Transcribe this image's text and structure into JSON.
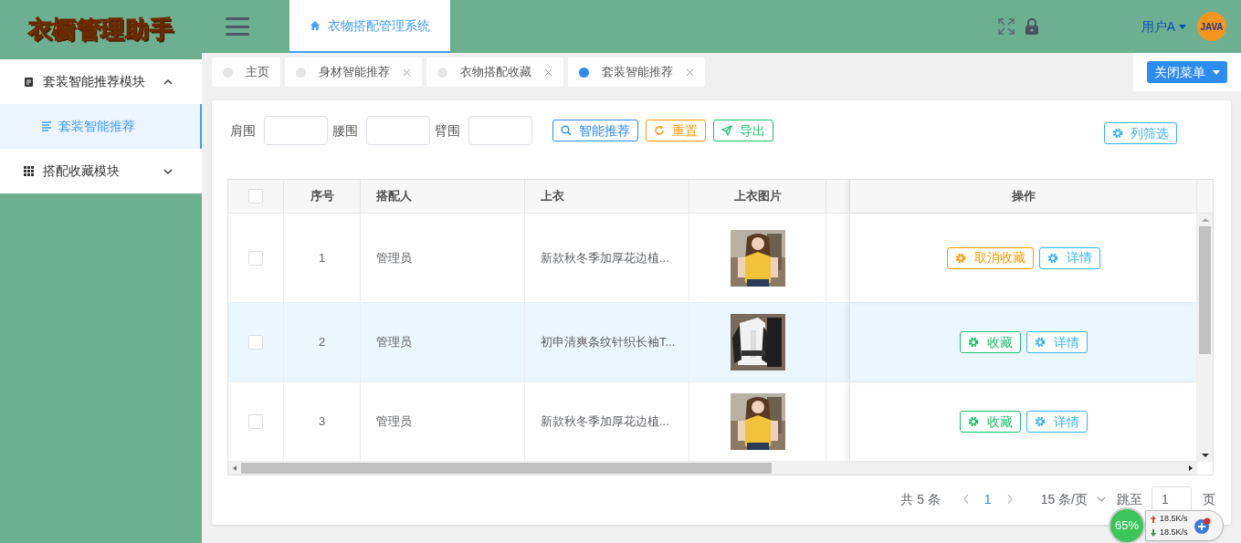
{
  "sidebar": {
    "logo": "衣橱管理助手",
    "menu": [
      {
        "label": "套装智能推荐模块",
        "expanded": true,
        "children": [
          {
            "label": "套装智能推荐",
            "selected": true
          }
        ]
      },
      {
        "label": "搭配收藏模块",
        "expanded": false
      }
    ]
  },
  "header": {
    "tab": "衣物搭配管理系统",
    "user": "用户A",
    "avatar_text": "JAVA"
  },
  "tabs": [
    {
      "label": "主页",
      "selected": false,
      "closable": false
    },
    {
      "label": "身材智能推荐",
      "selected": false,
      "closable": true
    },
    {
      "label": "衣物搭配收藏",
      "selected": false,
      "closable": true
    },
    {
      "label": "套装智能推荐",
      "selected": true,
      "closable": true
    }
  ],
  "close_menu": "关闭菜单",
  "filters": [
    {
      "label": "肩围"
    },
    {
      "label": "腰围"
    },
    {
      "label": "臂围"
    }
  ],
  "toolbar": [
    {
      "label": "智能推荐",
      "kind": "search"
    },
    {
      "label": "重置",
      "kind": "reset"
    },
    {
      "label": "导出",
      "kind": "export"
    }
  ],
  "column_filter": "列筛选",
  "table": {
    "header_checked": false,
    "columns": [
      "序号",
      "搭配人",
      "上衣",
      "上衣图片",
      "操作"
    ],
    "rows": [
      {
        "checked": false,
        "selected": false,
        "index": "1",
        "person": "管理员",
        "top": "新款秋冬季加厚花边植...",
        "actions": [
          {
            "label": "取消收藏",
            "kind": "uncollect"
          },
          {
            "label": "详情",
            "kind": "detail"
          }
        ]
      },
      {
        "checked": false,
        "selected": true,
        "index": "2",
        "person": "管理员",
        "top": "初申清爽条纹针织长袖T...",
        "actions": [
          {
            "label": "收藏",
            "kind": "collect"
          },
          {
            "label": "详情",
            "kind": "detail"
          }
        ]
      },
      {
        "checked": false,
        "selected": false,
        "index": "3",
        "person": "管理员",
        "top": "新款秋冬季加厚花边植...",
        "actions": [
          {
            "label": "收藏",
            "kind": "collect"
          },
          {
            "label": "详情",
            "kind": "detail"
          }
        ]
      }
    ]
  },
  "pagination": {
    "total": "共 5 条",
    "pages": [
      {
        "label": "1",
        "selected": true
      }
    ],
    "page_size": "15 条/页",
    "jump_label": "跳至",
    "jump_value": "1",
    "page_unit": "页"
  },
  "net_widget": {
    "percent": "65%",
    "up": "18.5K/s",
    "down": "18.5K/s"
  }
}
